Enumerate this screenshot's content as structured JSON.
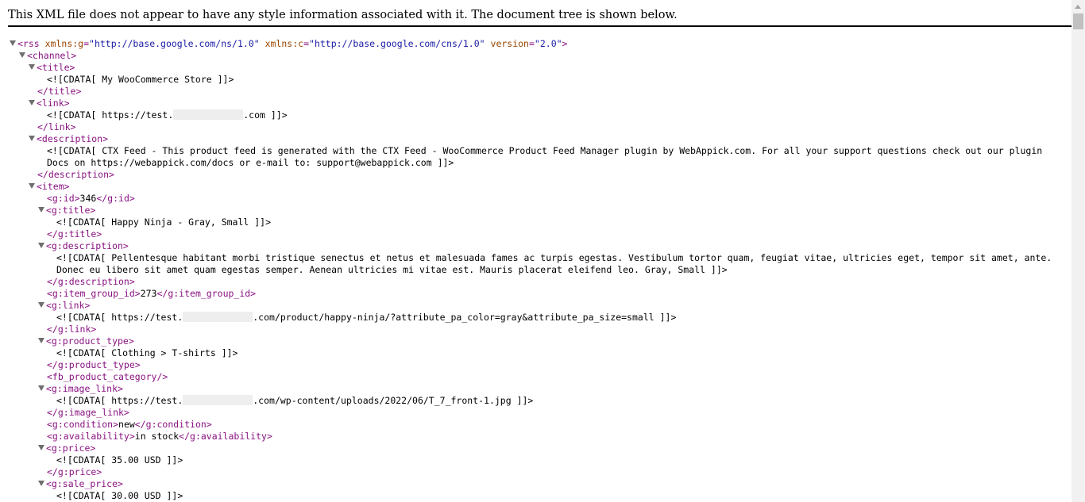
{
  "header": {
    "message": "This XML file does not appear to have any style information associated with it. The document tree is shown below."
  },
  "xml": {
    "rss_open": {
      "tag": "<rss ",
      "attrs": [
        {
          "name": "xmlns:g",
          "value": "\"http://base.google.com/ns/1.0\""
        },
        {
          "name": "xmlns:c",
          "value": "\"http://base.google.com/cns/1.0\""
        },
        {
          "name": "version",
          "value": "\"2.0\""
        }
      ]
    },
    "channel_open": "<channel>",
    "title_open": "<title>",
    "title_text": "<![CDATA[ My WooCommerce Store ]]>",
    "title_close": "</title>",
    "link_open": "<link>",
    "link_text_a": "<![CDATA[ https://test.",
    "link_text_b": ".com ]]>",
    "link_close": "</link>",
    "desc_open": "<description>",
    "desc_text_1": "<![CDATA[ CTX Feed - This product feed is generated with the CTX Feed - WooCommerce Product Feed Manager plugin by WebAppick.com. For all your support questions check out our plugin",
    "desc_text_2": "Docs on https://webappick.com/docs or e-mail to: support@webappick.com ]]>",
    "desc_close": "</description>",
    "item_open": "<item>",
    "gid_open": "<g:id>",
    "gid_value": "346",
    "gid_close": "</g:id>",
    "gtitle_open": "<g:title>",
    "gtitle_text": "<![CDATA[ Happy Ninja - Gray, Small ]]>",
    "gtitle_close": "</g:title>",
    "gdesc_open": "<g:description>",
    "gdesc_text_1": "<![CDATA[ Pellentesque habitant morbi tristique senectus et netus et malesuada fames ac turpis egestas. Vestibulum tortor quam, feugiat vitae, ultricies eget, tempor sit amet, ante.",
    "gdesc_text_2": "Donec eu libero sit amet quam egestas semper. Aenean ultricies mi vitae est. Mauris placerat eleifend leo. Gray, Small ]]>",
    "gdesc_close": "</g:description>",
    "igid_open": "<g:item_group_id>",
    "igid_value": "273",
    "igid_close": "</g:item_group_id>",
    "glink_open": "<g:link>",
    "glink_text_a": "<![CDATA[ https://test.",
    "glink_text_b": ".com/product/happy-ninja/?attribute_pa_color=gray&attribute_pa_size=small ]]>",
    "glink_close": "</g:link>",
    "ptype_open": "<g:product_type>",
    "ptype_text": "<![CDATA[ Clothing > T-shirts ]]>",
    "ptype_close": "</g:product_type>",
    "fbcat": "<fb_product_category/>",
    "img_open": "<g:image_link>",
    "img_text_a": "<![CDATA[ https://test.",
    "img_text_b": ".com/wp-content/uploads/2022/06/T_7_front-1.jpg ]]>",
    "img_close": "</g:image_link>",
    "cond_open": "<g:condition>",
    "cond_value": "new",
    "cond_close": "</g:condition>",
    "avail_open": "<g:availability>",
    "avail_value": "in stock",
    "avail_close": "</g:availability>",
    "price_open": "<g:price>",
    "price_text": "<![CDATA[ 35.00 USD ]]>",
    "price_close": "</g:price>",
    "sale_open": "<g:sale_price>",
    "sale_text": "<![CDATA[ 30.00 USD ]]>"
  },
  "colors": {
    "tag": "#881280",
    "attr_name": "#994500",
    "attr_value": "#1a1aa6",
    "text": "#000000"
  }
}
